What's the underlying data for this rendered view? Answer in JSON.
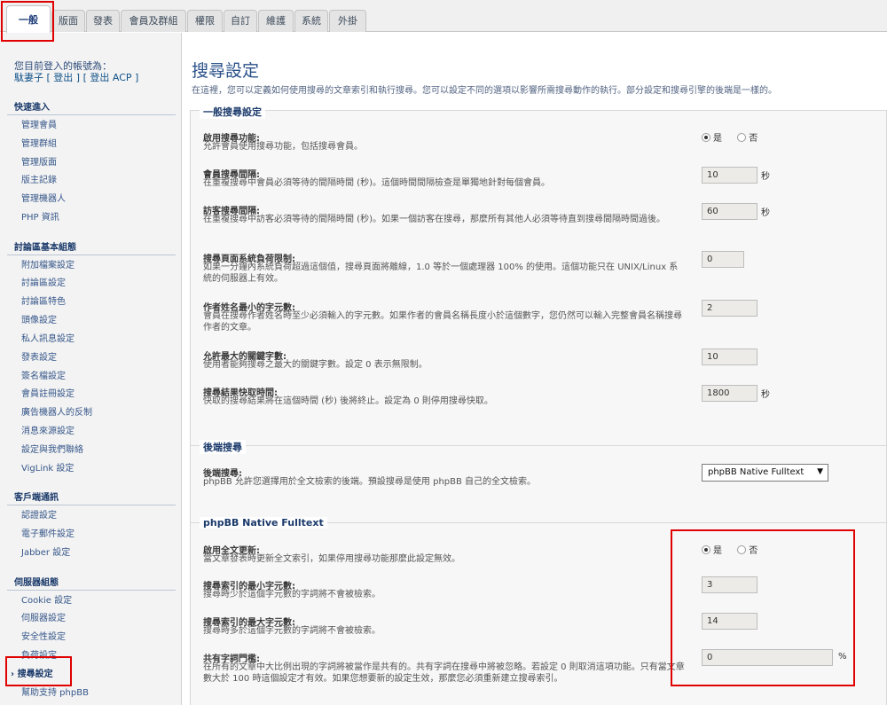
{
  "tabs": [
    {
      "label": "一般"
    },
    {
      "label": "版面"
    },
    {
      "label": "發表"
    },
    {
      "label": "會員及群組"
    },
    {
      "label": "權限"
    },
    {
      "label": "自訂"
    },
    {
      "label": "維護"
    },
    {
      "label": "系統"
    },
    {
      "label": "外掛"
    }
  ],
  "login": {
    "line1": "您目前登入的帳號為：",
    "username": "駄妻子",
    "logout": "[ 登出 ]",
    "logout_acp": "[ 登出 ACP ]"
  },
  "sidebar": {
    "sections": [
      {
        "title": "快速進入",
        "items": [
          "管理會員",
          "管理群組",
          "管理版面",
          "版主記錄",
          "管理機器人",
          "PHP 資訊"
        ]
      },
      {
        "title": "討論區基本組態",
        "items": [
          "附加檔案設定",
          "討論區設定",
          "討論區特色",
          "頭像設定",
          "私人訊息設定",
          "發表設定",
          "簽名檔設定",
          "會員註冊設定",
          "廣告機器人的反制",
          "消息來源設定",
          "設定與我們聯絡",
          "VigLink 設定"
        ]
      },
      {
        "title": "客戶端通訊",
        "items": [
          "認證設定",
          "電子郵件設定",
          "Jabber 設定"
        ]
      },
      {
        "title": "伺服器組態",
        "items": [
          "Cookie 設定",
          "伺服器設定",
          "安全性設定",
          "負荷設定",
          "搜尋設定",
          "幫助支持 phpBB"
        ]
      }
    ]
  },
  "page": {
    "title": "搜尋設定",
    "description": "在這裡，您可以定義如何使用搜尋的文章索引和執行搜尋。您可以設定不同的選項以影響所需搜尋動作的執行。部分設定和搜尋引擎的後端是一樣的。"
  },
  "general": {
    "legend": "一般搜尋設定",
    "rows": [
      {
        "label": "啟用搜尋功能:",
        "explain": "允許會員使用搜尋功能，包括搜尋會員。",
        "yes": "是",
        "no": "否"
      },
      {
        "label": "會員搜尋間隔:",
        "explain": "在重複搜尋中會員必須等待的間隔時間 (秒)。這個時間間隔檢查是單獨地針對每個會員。",
        "value": "10",
        "unit": "秒"
      },
      {
        "label": "訪客搜尋間隔:",
        "explain": "在重複搜尋中訪客必須等待的間隔時間 (秒)。如果一個訪客在搜尋，那麼所有其他人必須等待直到搜尋間隔時間過後。",
        "value": "60",
        "unit": "秒"
      },
      {
        "label": "搜尋頁面系統負荷限制:",
        "explain": "如果一分鐘內系統負荷超過這個值，搜尋頁面將離線，1.0 等於一個處理器 100% 的使用。這個功能只在 UNIX/Linux 系統的伺服器上有效。",
        "value": "0"
      },
      {
        "label": "作者姓名最小的字元數:",
        "explain": "會員在搜尋作者姓名時至少必須輸入的字元數。如果作者的會員名稱長度小於這個數字，您仍然可以輸入完整會員名稱搜尋作者的文章。",
        "value": "2"
      },
      {
        "label": "允許最大的關鍵字數:",
        "explain": "使用者能夠搜尋之最大的關鍵字數。設定 0 表示無限制。",
        "value": "10"
      },
      {
        "label": "搜尋結果快取時間:",
        "explain": "快取的搜尋結果將在這個時間 (秒) 後將終止。設定為 0 則停用搜尋快取。",
        "value": "1800",
        "unit": "秒"
      }
    ]
  },
  "backend": {
    "legend": "後端搜尋",
    "label": "後端搜尋:",
    "explain": "phpBB 允許您選擇用於全文檢索的後端。預設搜尋是使用 phpBB 自己的全文檢索。",
    "selected": "phpBB Native Fulltext",
    "arrow": "▼"
  },
  "native": {
    "legend": "phpBB Native Fulltext",
    "rows": [
      {
        "label": "啟用全文更新:",
        "explain": "當文章發表時更新全文索引，如果停用搜尋功能那麼此設定無效。",
        "yes": "是",
        "no": "否"
      },
      {
        "label": "搜尋索引的最小字元數:",
        "explain": "搜尋時少於這個字元數的字詞將不會被檢索。",
        "value": "3"
      },
      {
        "label": "搜尋索引的最大字元數:",
        "explain": "搜尋時多於這個字元數的字詞將不會被檢索。",
        "value": "14"
      },
      {
        "label": "共有字詞門檻:",
        "explain": "在所有的文章中大比例出現的字詞將被當作是共有的。共有字詞在搜尋中將被忽略。若設定 0 則取消這項功能。只有當文章數大於 100 時這個設定才有效。如果您想要新的設定生效，那麼您必須重新建立搜尋索引。",
        "value": "0",
        "unit": "%"
      }
    ]
  },
  "colors": {
    "highlight": "#e00000",
    "accent": "#2a5189"
  }
}
